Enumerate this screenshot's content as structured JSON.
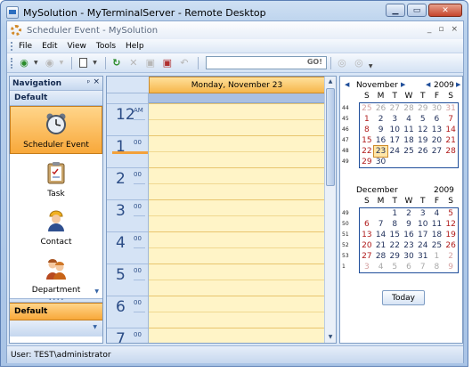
{
  "remote_desktop": {
    "title": "MySolution - MyTerminalServer - Remote Desktop"
  },
  "app": {
    "title": "Scheduler Event - MySolution",
    "title_controls": [
      "_",
      "▫",
      "×"
    ]
  },
  "menu": [
    "File",
    "Edit",
    "View",
    "Tools",
    "Help"
  ],
  "toolbar": {
    "search_go": "GO!"
  },
  "navigation": {
    "header": "Navigation",
    "pin": "ᵖ",
    "close": "×",
    "group": "Default",
    "items": [
      {
        "label": "Scheduler Event",
        "icon": "alarm-clock-icon",
        "selected": true
      },
      {
        "label": "Task",
        "icon": "clipboard-icon",
        "selected": false
      },
      {
        "label": "Contact",
        "icon": "person-icon",
        "selected": false
      },
      {
        "label": "Department",
        "icon": "people-icon",
        "selected": false
      }
    ],
    "bottom_group": "Default"
  },
  "day_view": {
    "header": "Monday, November 23",
    "hours": [
      {
        "num": "12",
        "sup": "AM"
      },
      {
        "num": "1",
        "sup": "00"
      },
      {
        "num": "2",
        "sup": "00"
      },
      {
        "num": "3",
        "sup": "00"
      },
      {
        "num": "4",
        "sup": "00"
      },
      {
        "num": "5",
        "sup": "00"
      },
      {
        "num": "6",
        "sup": "00"
      },
      {
        "num": "7",
        "sup": "00"
      }
    ]
  },
  "calendar": {
    "dow": [
      "S",
      "M",
      "T",
      "W",
      "T",
      "F",
      "S"
    ],
    "months": [
      {
        "name": "November",
        "year": "2009",
        "weeks": [
          "44",
          "45",
          "46",
          "47",
          "48",
          "49"
        ],
        "days": [
          [
            [
              "25",
              "o"
            ],
            [
              "26",
              "o"
            ],
            [
              "27",
              "o"
            ],
            [
              "28",
              "o"
            ],
            [
              "29",
              "o"
            ],
            [
              "30",
              "o"
            ],
            [
              "31",
              "o"
            ]
          ],
          [
            [
              "1",
              ""
            ],
            [
              "2",
              ""
            ],
            [
              "3",
              ""
            ],
            [
              "4",
              ""
            ],
            [
              "5",
              ""
            ],
            [
              "6",
              ""
            ],
            [
              "7",
              ""
            ]
          ],
          [
            [
              "8",
              ""
            ],
            [
              "9",
              ""
            ],
            [
              "10",
              ""
            ],
            [
              "11",
              ""
            ],
            [
              "12",
              ""
            ],
            [
              "13",
              ""
            ],
            [
              "14",
              ""
            ]
          ],
          [
            [
              "15",
              ""
            ],
            [
              "16",
              ""
            ],
            [
              "17",
              ""
            ],
            [
              "18",
              ""
            ],
            [
              "19",
              ""
            ],
            [
              "20",
              ""
            ],
            [
              "21",
              ""
            ]
          ],
          [
            [
              "22",
              ""
            ],
            [
              "23",
              "t"
            ],
            [
              "24",
              ""
            ],
            [
              "25",
              ""
            ],
            [
              "26",
              ""
            ],
            [
              "27",
              ""
            ],
            [
              "28",
              ""
            ]
          ],
          [
            [
              "29",
              ""
            ],
            [
              "30",
              ""
            ],
            [
              "",
              ""
            ],
            [
              "",
              ""
            ],
            [
              "",
              ""
            ],
            [
              "",
              ""
            ],
            [
              "",
              ""
            ]
          ]
        ]
      },
      {
        "name": "December",
        "year": "2009",
        "weeks": [
          "49",
          "50",
          "51",
          "52",
          "53",
          "1"
        ],
        "days": [
          [
            [
              "",
              ""
            ],
            [
              "",
              ""
            ],
            [
              "1",
              ""
            ],
            [
              "2",
              ""
            ],
            [
              "3",
              ""
            ],
            [
              "4",
              ""
            ],
            [
              "5",
              ""
            ]
          ],
          [
            [
              "6",
              ""
            ],
            [
              "7",
              ""
            ],
            [
              "8",
              ""
            ],
            [
              "9",
              ""
            ],
            [
              "10",
              ""
            ],
            [
              "11",
              ""
            ],
            [
              "12",
              ""
            ]
          ],
          [
            [
              "13",
              ""
            ],
            [
              "14",
              ""
            ],
            [
              "15",
              ""
            ],
            [
              "16",
              ""
            ],
            [
              "17",
              ""
            ],
            [
              "18",
              ""
            ],
            [
              "19",
              ""
            ]
          ],
          [
            [
              "20",
              ""
            ],
            [
              "21",
              ""
            ],
            [
              "22",
              ""
            ],
            [
              "23",
              ""
            ],
            [
              "24",
              ""
            ],
            [
              "25",
              ""
            ],
            [
              "26",
              ""
            ]
          ],
          [
            [
              "27",
              ""
            ],
            [
              "28",
              ""
            ],
            [
              "29",
              ""
            ],
            [
              "30",
              ""
            ],
            [
              "31",
              ""
            ],
            [
              "1",
              "o"
            ],
            [
              "2",
              "o"
            ]
          ],
          [
            [
              "3",
              "o"
            ],
            [
              "4",
              "o"
            ],
            [
              "5",
              "o"
            ],
            [
              "6",
              "o"
            ],
            [
              "7",
              "o"
            ],
            [
              "8",
              "o"
            ],
            [
              "9",
              "o"
            ]
          ]
        ]
      }
    ],
    "today_button": "Today"
  },
  "status": {
    "user": "User: TEST\\administrator"
  },
  "colors": {
    "accent_orange": "#f8a83a",
    "frame_blue": "#a9c4e6",
    "weekend_red": "#b01a1a"
  }
}
